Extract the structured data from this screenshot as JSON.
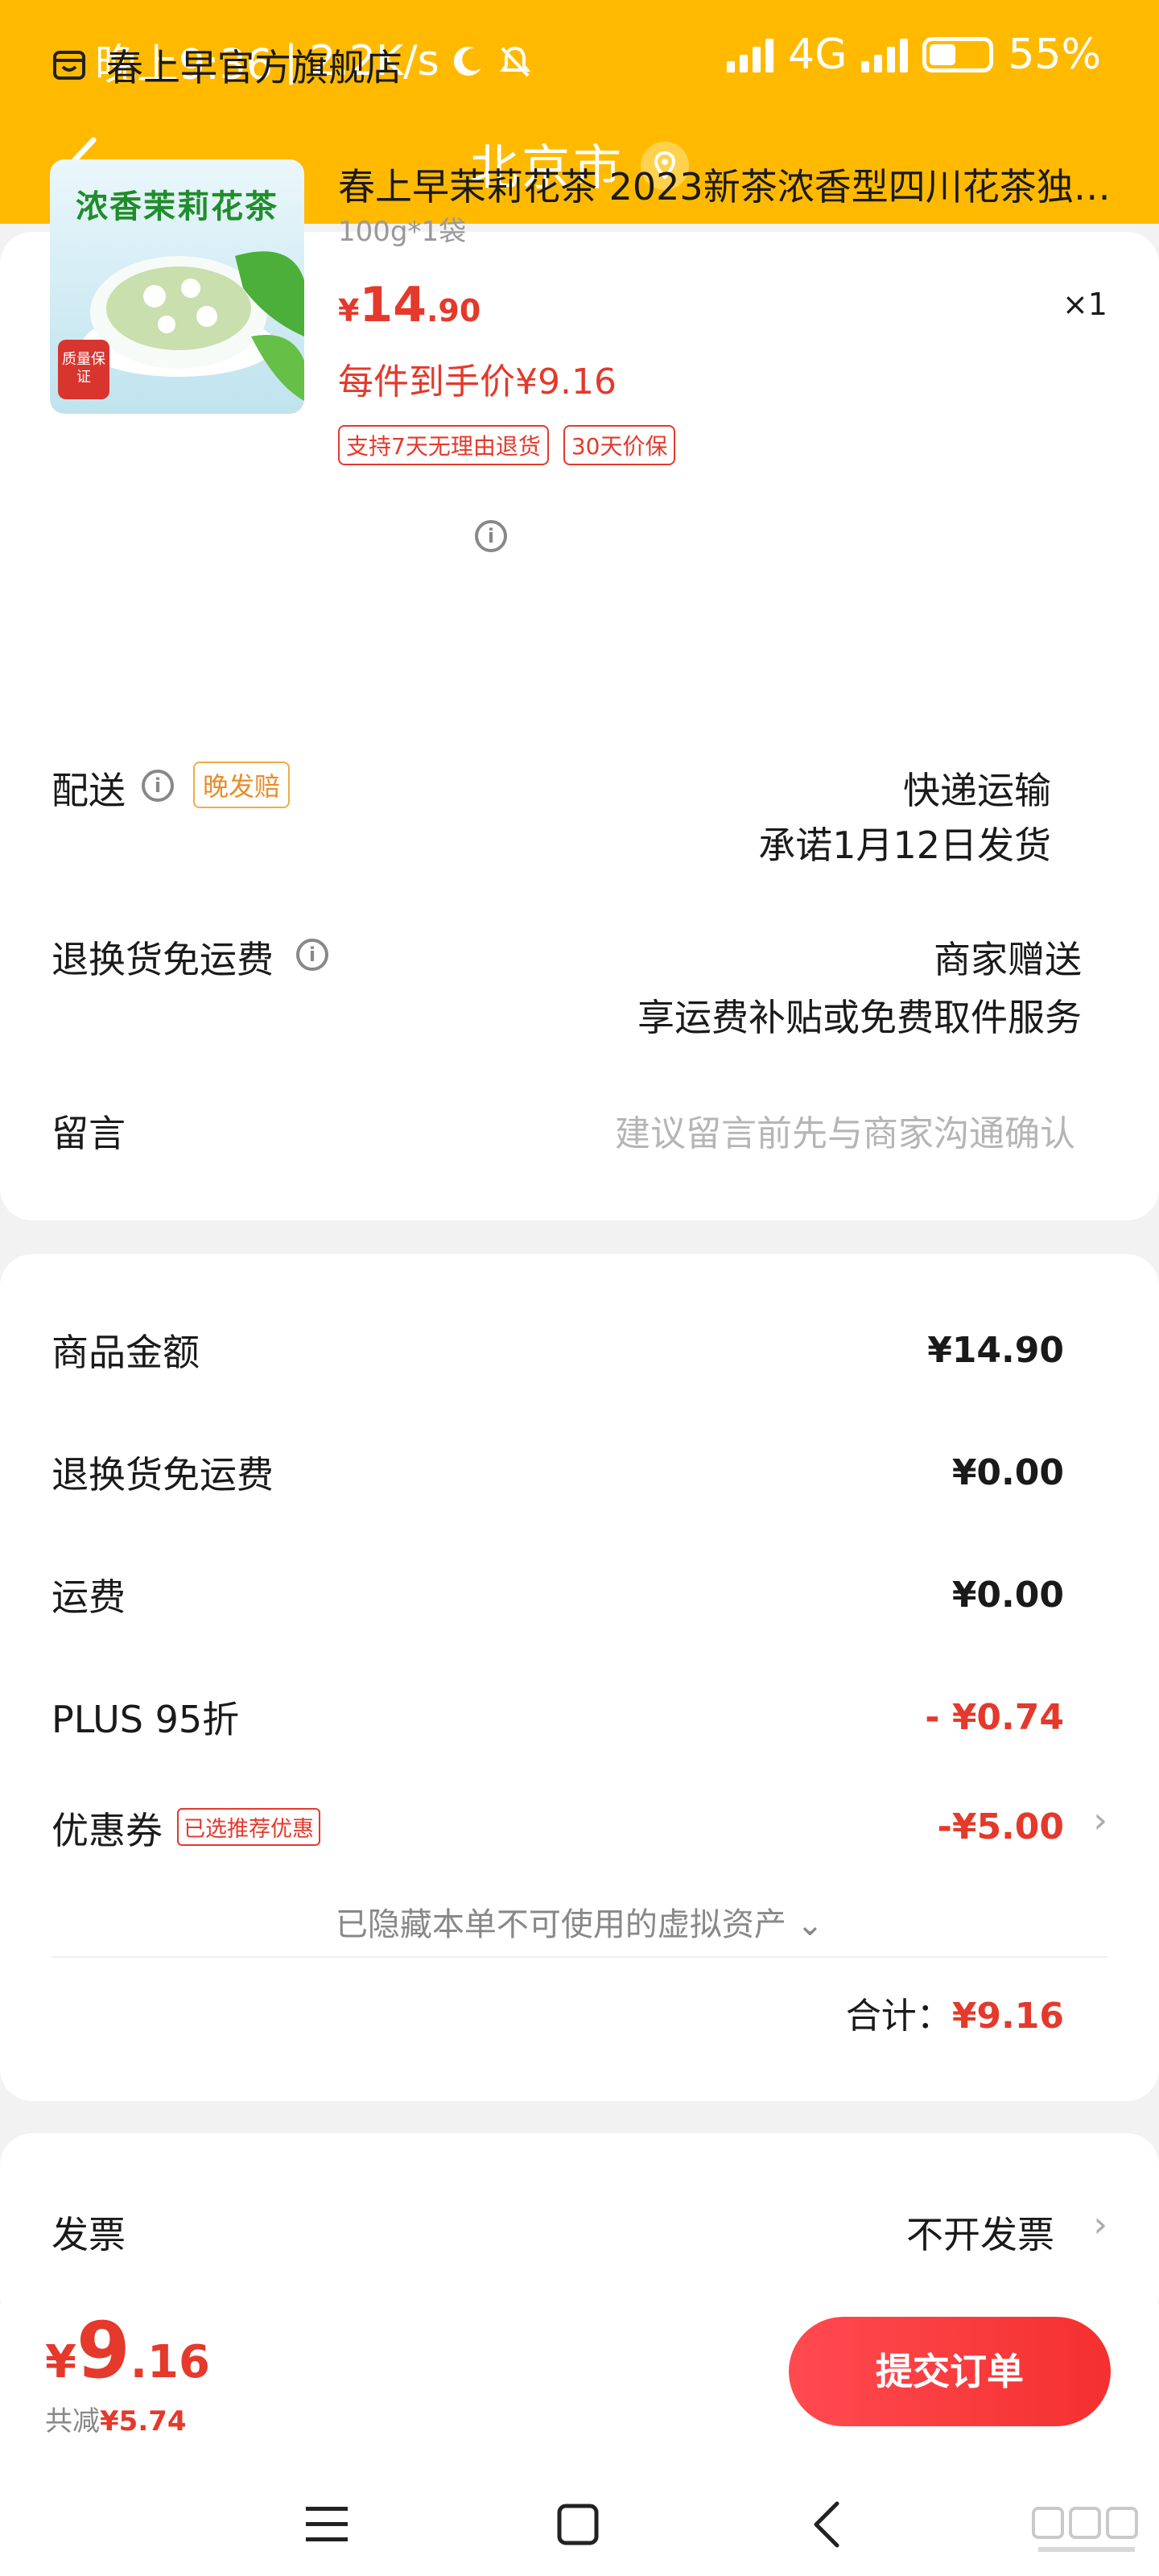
{
  "status_bar": {
    "time": "晚上9:36",
    "speed": "2.2K/s",
    "network": "4G",
    "battery": "55%"
  },
  "header": {
    "title": "北京市"
  },
  "store": {
    "name": "春上早官方旗舰店"
  },
  "product": {
    "image_text": "浓香茉莉花茶",
    "image_badge": "质量保证",
    "title": "春上早茉莉花茶 2023新茶浓香型四川花茶独…",
    "spec": "100g*1袋",
    "price_symbol": "¥",
    "price_int": "14",
    "price_dec": ".90",
    "quantity": "×1",
    "per_unit_price": "每件到手价¥9.16",
    "tags": [
      "支持7天无理由退货",
      "30天价保"
    ]
  },
  "delivery": {
    "label": "配送",
    "tag": "晚发赔",
    "method": "快递运输",
    "promise": "承诺1月12日发货"
  },
  "return_shipping": {
    "label": "退换货免运费",
    "value": "商家赠送",
    "desc": "享运费补贴或免费取件服务"
  },
  "message": {
    "label": "留言",
    "placeholder": "建议留言前先与商家沟通确认"
  },
  "summary": {
    "goods_amount": {
      "label": "商品金额",
      "value": "¥14.90"
    },
    "return_free": {
      "label": "退换货免运费",
      "value": "¥0.00"
    },
    "shipping": {
      "label": "运费",
      "value": "¥0.00"
    },
    "plus": {
      "label": "PLUS 95折",
      "value": "- ¥0.74"
    },
    "coupon": {
      "label": "优惠券",
      "tag": "已选推荐优惠",
      "value": "-¥5.00"
    },
    "hidden_assets": "已隐藏本单不可使用的虚拟资产 ⌄",
    "total_label": "合计：",
    "total_value": "¥9.16"
  },
  "invoice": {
    "label": "发票",
    "value": "不开发票"
  },
  "bottom_bar": {
    "price_symbol": "¥",
    "price_int": "9",
    "price_dec": ".16",
    "saved_label": "共减",
    "saved_value": "¥5.74",
    "submit_label": "提交订单"
  },
  "colors": {
    "accent_yellow": "#ffba00",
    "price_red": "#e4392b"
  }
}
